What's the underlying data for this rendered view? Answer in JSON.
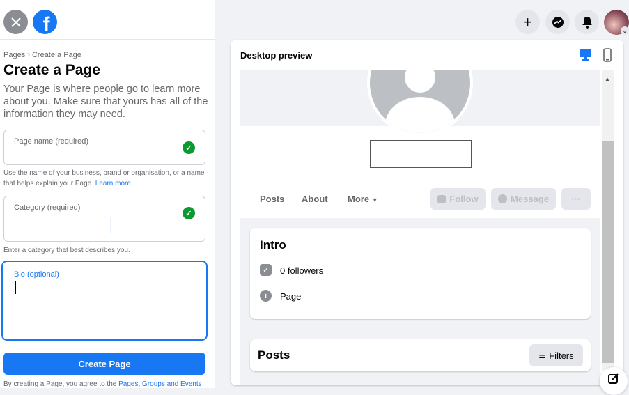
{
  "left": {
    "breadcrumb": "Pages › Create a Page",
    "title": "Create a Page",
    "description": "Your Page is where people go to learn more about you. Make sure that yours has all of the information they may need.",
    "page_name": {
      "label": "Page name (required)",
      "value": "",
      "help": "Use the name of your business, brand or organisation, or a name that helps explain your Page.",
      "help_link": "Learn more"
    },
    "category": {
      "label": "Category (required)",
      "value": "",
      "help": "Enter a category that best describes you."
    },
    "bio": {
      "label": "Bio (optional)",
      "value": ""
    },
    "create_button": "Create Page",
    "terms": "By creating a Page, you agree to the ",
    "terms_link": "Pages, Groups and Events"
  },
  "preview": {
    "title": "Desktop preview",
    "tabs": [
      "Posts",
      "About",
      "More"
    ],
    "follow": "Follow",
    "message": "Message",
    "more_dots": "···",
    "intro": {
      "title": "Intro",
      "followers": "0 followers",
      "category": "Page"
    },
    "posts": {
      "title": "Posts",
      "filters": "Filters"
    }
  },
  "colors": {
    "brand": "#1877f2",
    "success": "#0a9a2f"
  }
}
